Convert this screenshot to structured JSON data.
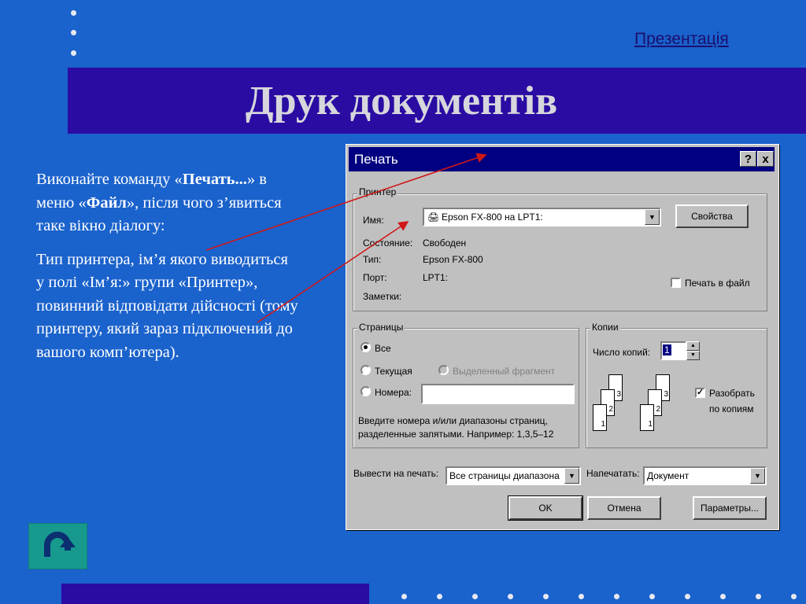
{
  "slide": {
    "title": "Друк документів",
    "presentation_link": "Презентація",
    "paragraph1": {
      "part1": "Виконайте команду «",
      "bold1": "Печать...",
      "part2": "» в меню «",
      "bold2": "Файл",
      "part3": "», після чого з’явиться таке вікно діалогу:"
    },
    "paragraph2": "Тип принтера, ім’я якого виводиться у полі «Ім’я:» групи «Принтер», повинний відповідати дійсності (тому принтеру, який зараз підключений до вашого комп’ютера).",
    "back_button_icon": "u-turn-icon",
    "accent_color": "#1a62cc",
    "band_color": "#2a0ca3"
  },
  "dialog": {
    "title": "Печать",
    "help_btn": "?",
    "close_btn": "x",
    "printer_group": {
      "label": "Принтер",
      "name_label": "Имя:",
      "name_value": "Epson FX-800 на LPT1:",
      "properties_button": "Свойства",
      "state_label": "Состояние:",
      "state_value": "Свободен",
      "type_label": "Тип:",
      "type_value": "Epson FX-800",
      "port_label": "Порт:",
      "port_value": "LPT1:",
      "notes_label": "Заметки:",
      "print_to_file_label": "Печать в файл",
      "print_to_file_checked": false
    },
    "pages_group": {
      "label": "Страницы",
      "all_label": "Все",
      "current_label": "Текущая",
      "selection_label": "Выделенный фрагмент",
      "numbers_label": "Номера:",
      "numbers_value": "",
      "selected": "all",
      "hint_line1": "Введите номера и/или диапазоны страниц,",
      "hint_line2": "разделенные запятыми. Например: 1,3,5–12"
    },
    "copies_group": {
      "label": "Копии",
      "count_label": "Число копий:",
      "count_value": "1",
      "collate_label_line1": "Разобрать",
      "collate_label_line2": "по копиям",
      "collate_checked": true,
      "page_numbers": [
        "1",
        "2",
        "3"
      ]
    },
    "print_what_label": "Вывести на печать:",
    "print_what_value": "Все страницы диапазона",
    "print_label": "Напечатать:",
    "print_value": "Документ",
    "ok_button": "OK",
    "cancel_button": "Отмена",
    "options_button": "Параметры..."
  }
}
